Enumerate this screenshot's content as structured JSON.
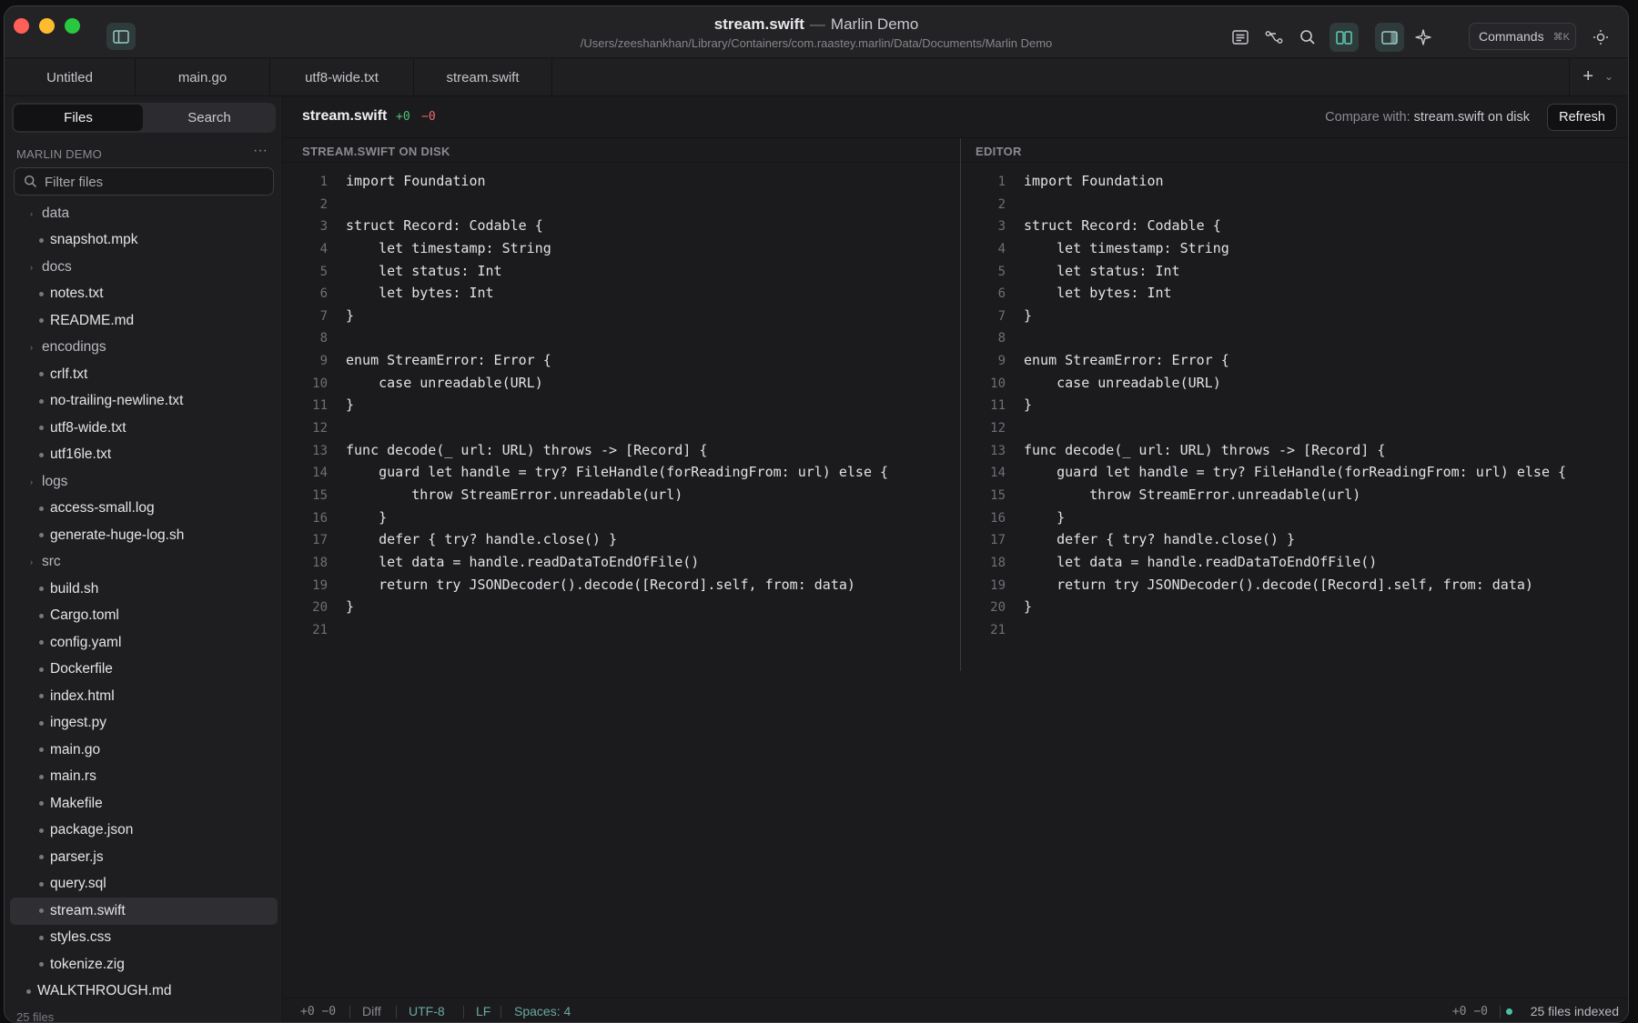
{
  "window": {
    "title": "stream.swift",
    "separator": "—",
    "app_name": "Marlin Demo",
    "path": "/Users/zeeshankhan/Library/Containers/com.raastey.marlin/Data/Documents/Marlin Demo"
  },
  "toolbar": {
    "icons": [
      "outline-icon",
      "git-branch-icon",
      "search-icon",
      "split-view-icon",
      "inspector-panel-icon",
      "sparkle-icon",
      "brightness-icon"
    ],
    "commands_label": "Commands",
    "commands_shortcut": "⌘K"
  },
  "tabs": [
    {
      "label": "Untitled"
    },
    {
      "label": "main.go"
    },
    {
      "label": "utf8-wide.txt"
    },
    {
      "label": "stream.swift"
    }
  ],
  "tabbar": {
    "add": "+",
    "menu": "⌄"
  },
  "sidebar": {
    "segments": [
      "Files",
      "Search"
    ],
    "project_name": "MARLIN DEMO",
    "more": "···",
    "filter_placeholder": "Filter files",
    "tree": [
      {
        "label": "data",
        "type": "folder",
        "depth": 0
      },
      {
        "label": "snapshot.mpk",
        "type": "file",
        "depth": 1
      },
      {
        "label": "docs",
        "type": "folder",
        "depth": 0
      },
      {
        "label": "notes.txt",
        "type": "file",
        "depth": 1
      },
      {
        "label": "README.md",
        "type": "file",
        "depth": 1
      },
      {
        "label": "encodings",
        "type": "folder",
        "depth": 0
      },
      {
        "label": "crlf.txt",
        "type": "file",
        "depth": 1
      },
      {
        "label": "no-trailing-newline.txt",
        "type": "file",
        "depth": 1
      },
      {
        "label": "utf8-wide.txt",
        "type": "file",
        "depth": 1
      },
      {
        "label": "utf16le.txt",
        "type": "file",
        "depth": 1
      },
      {
        "label": "logs",
        "type": "folder",
        "depth": 0
      },
      {
        "label": "access-small.log",
        "type": "file",
        "depth": 1
      },
      {
        "label": "generate-huge-log.sh",
        "type": "file",
        "depth": 1
      },
      {
        "label": "src",
        "type": "folder",
        "depth": 0
      },
      {
        "label": "build.sh",
        "type": "file",
        "depth": 1
      },
      {
        "label": "Cargo.toml",
        "type": "file",
        "depth": 1
      },
      {
        "label": "config.yaml",
        "type": "file",
        "depth": 1
      },
      {
        "label": "Dockerfile",
        "type": "file",
        "depth": 1
      },
      {
        "label": "index.html",
        "type": "file",
        "depth": 1
      },
      {
        "label": "ingest.py",
        "type": "file",
        "depth": 1
      },
      {
        "label": "main.go",
        "type": "file",
        "depth": 1
      },
      {
        "label": "main.rs",
        "type": "file",
        "depth": 1
      },
      {
        "label": "Makefile",
        "type": "file",
        "depth": 1
      },
      {
        "label": "package.json",
        "type": "file",
        "depth": 1
      },
      {
        "label": "parser.js",
        "type": "file",
        "depth": 1
      },
      {
        "label": "query.sql",
        "type": "file",
        "depth": 1
      },
      {
        "label": "stream.swift",
        "type": "file",
        "depth": 1,
        "selected": true
      },
      {
        "label": "styles.css",
        "type": "file",
        "depth": 1
      },
      {
        "label": "tokenize.zig",
        "type": "file",
        "depth": 1
      },
      {
        "label": "WALKTHROUGH.md",
        "type": "file",
        "depth": 0
      }
    ],
    "file_count": "25 files"
  },
  "diff": {
    "file_name": "stream.swift",
    "additions": "+0",
    "deletions": "−0",
    "compare_prefix": "Compare with:",
    "compare_target": "stream.swift on disk",
    "refresh_label": "Refresh",
    "left_header": "STREAM.SWIFT ON DISK",
    "right_header": "EDITOR",
    "lines": [
      "import Foundation",
      "",
      "struct Record: Codable {",
      "    let timestamp: String",
      "    let status: Int",
      "    let bytes: Int",
      "}",
      "",
      "enum StreamError: Error {",
      "    case unreadable(URL)",
      "}",
      "",
      "func decode(_ url: URL) throws -> [Record] {",
      "    guard let handle = try? FileHandle(forReadingFrom: url) else {",
      "        throw StreamError.unreadable(url)",
      "    }",
      "    defer { try? handle.close() }",
      "    let data = handle.readDataToEndOfFile()",
      "    return try JSONDecoder().decode([Record].self, from: data)",
      "}",
      ""
    ]
  },
  "status": {
    "left_changes": "+0 −0",
    "mode": "Diff",
    "encoding": "UTF-8",
    "line_ending": "LF",
    "indent": "Spaces: 4",
    "right_changes": "+0 −0",
    "indexed": "25 files indexed"
  },
  "colors": {
    "accent": "#6aa7a0",
    "addition": "#4fc27a",
    "deletion": "#f06b6b",
    "index_dot": "#4fbfa4"
  }
}
